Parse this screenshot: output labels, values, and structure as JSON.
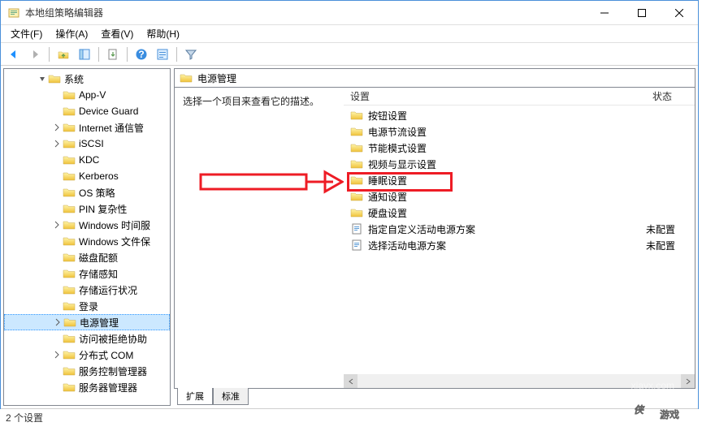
{
  "window": {
    "title": "本地组策略编辑器"
  },
  "menu": {
    "file": "文件(F)",
    "action": "操作(A)",
    "view": "查看(V)",
    "help": "帮助(H)"
  },
  "tree": {
    "root": "系统",
    "items": [
      "App-V",
      "Device Guard",
      "Internet 通信管",
      "iSCSI",
      "KDC",
      "Kerberos",
      "OS 策略",
      "PIN 复杂性",
      "Windows 时间服",
      "Windows 文件保",
      "磁盘配额",
      "存储感知",
      "存储运行状况",
      "登录",
      "电源管理",
      "访问被拒绝协助",
      "分布式 COM",
      "服务控制管理器",
      "服务器管理器"
    ],
    "selected": "电源管理",
    "expandable": [
      "Internet 通信管",
      "iSCSI",
      "Windows 时间服",
      "电源管理",
      "分布式 COM"
    ]
  },
  "path": {
    "label": "电源管理"
  },
  "description": "选择一个项目来查看它的描述。",
  "columns": {
    "setting": "设置",
    "state": "状态"
  },
  "list": [
    {
      "type": "folder",
      "label": "按钮设置",
      "state": ""
    },
    {
      "type": "folder",
      "label": "电源节流设置",
      "state": ""
    },
    {
      "type": "folder",
      "label": "节能模式设置",
      "state": ""
    },
    {
      "type": "folder",
      "label": "视频与显示设置",
      "state": ""
    },
    {
      "type": "folder",
      "label": "睡眠设置",
      "state": ""
    },
    {
      "type": "folder",
      "label": "通知设置",
      "state": ""
    },
    {
      "type": "folder",
      "label": "硬盘设置",
      "state": ""
    },
    {
      "type": "doc",
      "label": "指定自定义活动电源方案",
      "state": "未配置"
    },
    {
      "type": "doc",
      "label": "选择活动电源方案",
      "state": "未配置"
    }
  ],
  "tabs": {
    "extended": "扩展",
    "standard": "标准"
  },
  "statusbar": "2 个设置",
  "watermark": {
    "brand": "侠游戏",
    "url": "xiayx.com"
  }
}
